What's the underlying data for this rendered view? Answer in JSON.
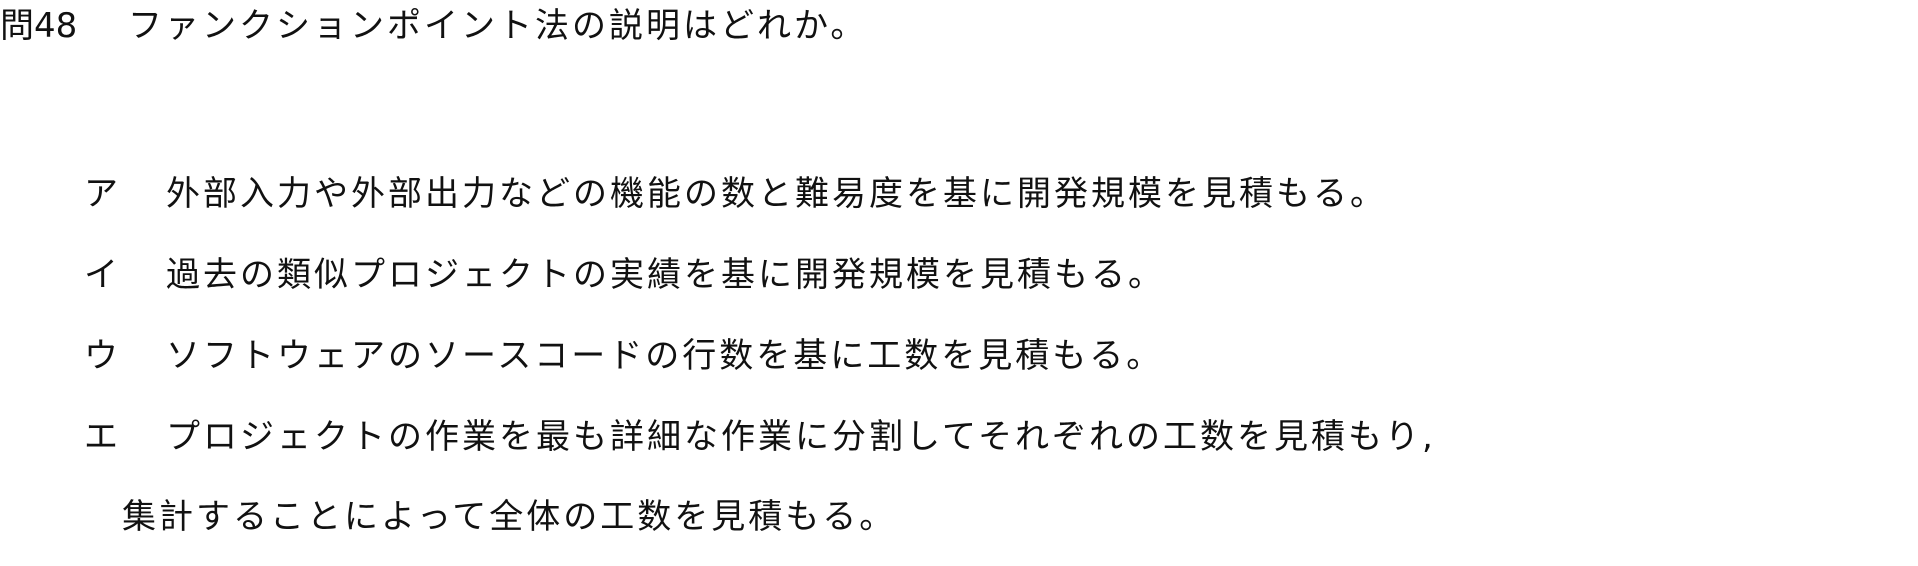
{
  "question": {
    "number": "問48",
    "text": "ファンクションポイント法の説明はどれか。"
  },
  "choices": [
    {
      "label": "ア",
      "text": "外部入力や外部出力などの機能の数と難易度を基に開発規模を見積もる。"
    },
    {
      "label": "イ",
      "text": "過去の類似プロジェクトの実績を基に開発規模を見積もる。"
    },
    {
      "label": "ウ",
      "text": "ソフトウェアのソースコードの行数を基に工数を見積もる。"
    },
    {
      "label": "エ",
      "text": "プロジェクトの作業を最も詳細な作業に分割してそれぞれの工数を見積もり,",
      "continuation": "集計することによって全体の工数を見積もる。"
    }
  ]
}
